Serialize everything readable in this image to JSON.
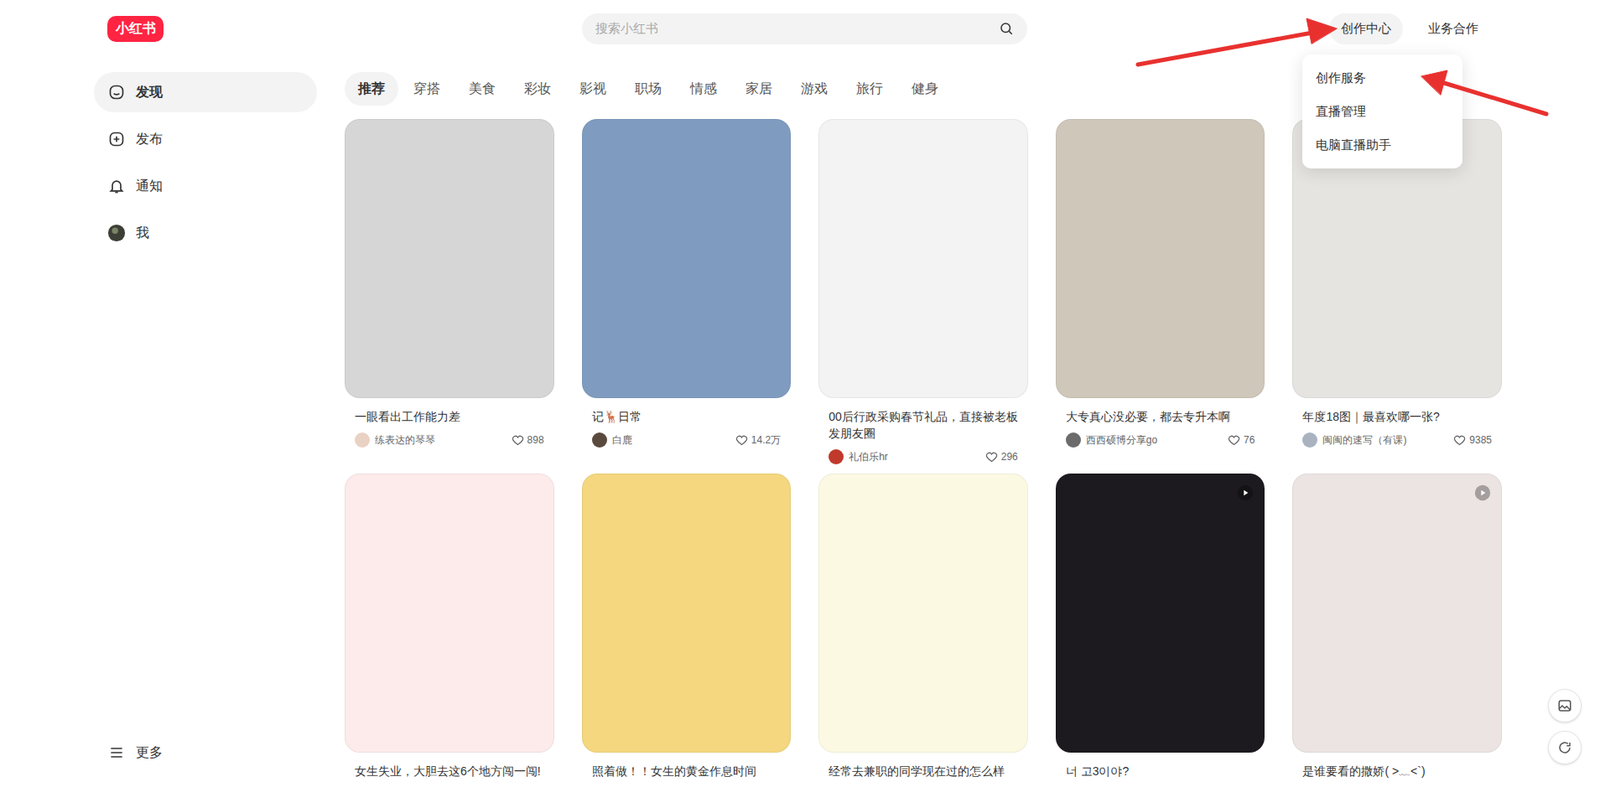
{
  "logo": "小红书",
  "search": {
    "placeholder": "搜索小红书"
  },
  "header_links": [
    {
      "label": "创作中心",
      "selected": true
    },
    {
      "label": "业务合作",
      "selected": false
    }
  ],
  "dropdown": [
    "创作服务",
    "直播管理",
    "电脑直播助手"
  ],
  "sidebar": {
    "items": [
      {
        "label": "发现",
        "selected": true
      },
      {
        "label": "发布",
        "selected": false
      },
      {
        "label": "通知",
        "selected": false
      },
      {
        "label": "我",
        "selected": false
      }
    ],
    "more": "更多"
  },
  "tabs": [
    {
      "label": "推荐",
      "selected": true
    },
    {
      "label": "穿搭",
      "selected": false
    },
    {
      "label": "美食",
      "selected": false
    },
    {
      "label": "彩妆",
      "selected": false
    },
    {
      "label": "影视",
      "selected": false
    },
    {
      "label": "职场",
      "selected": false
    },
    {
      "label": "情感",
      "selected": false
    },
    {
      "label": "家居",
      "selected": false
    },
    {
      "label": "游戏",
      "selected": false
    },
    {
      "label": "旅行",
      "selected": false
    },
    {
      "label": "健身",
      "selected": false
    }
  ],
  "cards": [
    {
      "title": "一眼看出工作能力差",
      "author": "练表达的琴琴",
      "likes": "898",
      "color": "#d6d6d6",
      "video": false
    },
    {
      "title": "记🦌日常",
      "author": "白鹿",
      "likes": "14.2万",
      "color": "#7f9cc0",
      "video": false
    },
    {
      "title": "00后行政采购春节礼品，直接被老板发朋友圈",
      "author": "礼伯乐hr",
      "likes": "296",
      "color": "#f3f3f3",
      "video": false
    },
    {
      "title": "大专真心没必要，都去专升本啊",
      "author": "西西硕博分享go",
      "likes": "76",
      "color": "#cfc7ba",
      "video": false
    },
    {
      "title": "年度18图｜最喜欢哪一张?",
      "author": "闽闽的速写（有课)",
      "likes": "9385",
      "color": "#e6e4e1",
      "video": false
    },
    {
      "title": "女生失业，大胆去这6个地方闯一闯!",
      "author": null,
      "likes": null,
      "color": "#fdeaea",
      "video": false
    },
    {
      "title": "照着做！！女生的黄金作息时间",
      "author": null,
      "likes": null,
      "color": "#f4d77e",
      "video": false
    },
    {
      "title": "经常去兼职的同学现在过的怎么样",
      "author": null,
      "likes": null,
      "color": "#fcf9e3",
      "video": false
    },
    {
      "title": "너 고3이야?",
      "author": null,
      "likes": null,
      "color": "#1c1a1f",
      "video": true
    },
    {
      "title": "是谁要看的撒娇( >﹏<`)",
      "author": null,
      "likes": null,
      "color": "#ebe4e2",
      "video": true
    }
  ]
}
